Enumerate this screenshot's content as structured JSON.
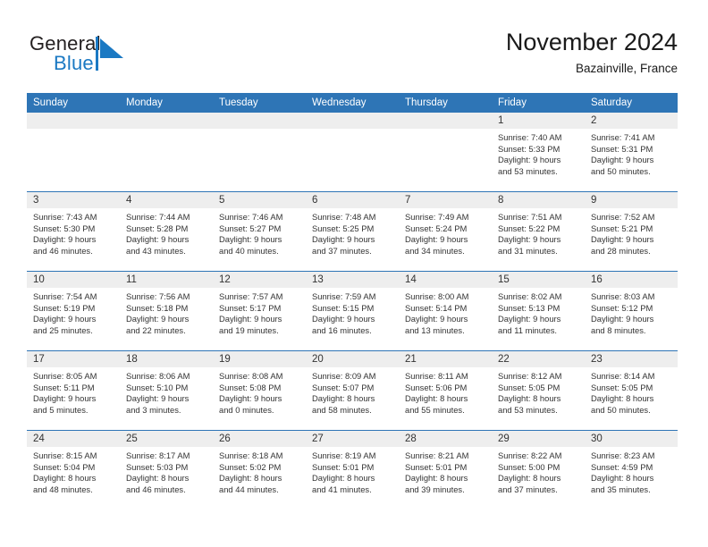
{
  "brand": {
    "word_one": "General",
    "word_two": "Blue",
    "mark_icon": "blue-triangle-flag-icon"
  },
  "header": {
    "title": "November 2024",
    "subtitle": "Bazainville, France"
  },
  "colors": {
    "header_bar": "#2e75b6",
    "day_band": "#eeeeee",
    "brand_blue": "#1b79c3",
    "text": "#333333"
  },
  "weekdays": [
    "Sunday",
    "Monday",
    "Tuesday",
    "Wednesday",
    "Thursday",
    "Friday",
    "Saturday"
  ],
  "weeks": [
    [
      {
        "day": "",
        "empty": true
      },
      {
        "day": "",
        "empty": true
      },
      {
        "day": "",
        "empty": true
      },
      {
        "day": "",
        "empty": true
      },
      {
        "day": "",
        "empty": true
      },
      {
        "day": "1",
        "sunrise": "Sunrise: 7:40 AM",
        "sunset": "Sunset: 5:33 PM",
        "daylight_1": "Daylight: 9 hours",
        "daylight_2": "and 53 minutes."
      },
      {
        "day": "2",
        "sunrise": "Sunrise: 7:41 AM",
        "sunset": "Sunset: 5:31 PM",
        "daylight_1": "Daylight: 9 hours",
        "daylight_2": "and 50 minutes."
      }
    ],
    [
      {
        "day": "3",
        "sunrise": "Sunrise: 7:43 AM",
        "sunset": "Sunset: 5:30 PM",
        "daylight_1": "Daylight: 9 hours",
        "daylight_2": "and 46 minutes."
      },
      {
        "day": "4",
        "sunrise": "Sunrise: 7:44 AM",
        "sunset": "Sunset: 5:28 PM",
        "daylight_1": "Daylight: 9 hours",
        "daylight_2": "and 43 minutes."
      },
      {
        "day": "5",
        "sunrise": "Sunrise: 7:46 AM",
        "sunset": "Sunset: 5:27 PM",
        "daylight_1": "Daylight: 9 hours",
        "daylight_2": "and 40 minutes."
      },
      {
        "day": "6",
        "sunrise": "Sunrise: 7:48 AM",
        "sunset": "Sunset: 5:25 PM",
        "daylight_1": "Daylight: 9 hours",
        "daylight_2": "and 37 minutes."
      },
      {
        "day": "7",
        "sunrise": "Sunrise: 7:49 AM",
        "sunset": "Sunset: 5:24 PM",
        "daylight_1": "Daylight: 9 hours",
        "daylight_2": "and 34 minutes."
      },
      {
        "day": "8",
        "sunrise": "Sunrise: 7:51 AM",
        "sunset": "Sunset: 5:22 PM",
        "daylight_1": "Daylight: 9 hours",
        "daylight_2": "and 31 minutes."
      },
      {
        "day": "9",
        "sunrise": "Sunrise: 7:52 AM",
        "sunset": "Sunset: 5:21 PM",
        "daylight_1": "Daylight: 9 hours",
        "daylight_2": "and 28 minutes."
      }
    ],
    [
      {
        "day": "10",
        "sunrise": "Sunrise: 7:54 AM",
        "sunset": "Sunset: 5:19 PM",
        "daylight_1": "Daylight: 9 hours",
        "daylight_2": "and 25 minutes."
      },
      {
        "day": "11",
        "sunrise": "Sunrise: 7:56 AM",
        "sunset": "Sunset: 5:18 PM",
        "daylight_1": "Daylight: 9 hours",
        "daylight_2": "and 22 minutes."
      },
      {
        "day": "12",
        "sunrise": "Sunrise: 7:57 AM",
        "sunset": "Sunset: 5:17 PM",
        "daylight_1": "Daylight: 9 hours",
        "daylight_2": "and 19 minutes."
      },
      {
        "day": "13",
        "sunrise": "Sunrise: 7:59 AM",
        "sunset": "Sunset: 5:15 PM",
        "daylight_1": "Daylight: 9 hours",
        "daylight_2": "and 16 minutes."
      },
      {
        "day": "14",
        "sunrise": "Sunrise: 8:00 AM",
        "sunset": "Sunset: 5:14 PM",
        "daylight_1": "Daylight: 9 hours",
        "daylight_2": "and 13 minutes."
      },
      {
        "day": "15",
        "sunrise": "Sunrise: 8:02 AM",
        "sunset": "Sunset: 5:13 PM",
        "daylight_1": "Daylight: 9 hours",
        "daylight_2": "and 11 minutes."
      },
      {
        "day": "16",
        "sunrise": "Sunrise: 8:03 AM",
        "sunset": "Sunset: 5:12 PM",
        "daylight_1": "Daylight: 9 hours",
        "daylight_2": "and 8 minutes."
      }
    ],
    [
      {
        "day": "17",
        "sunrise": "Sunrise: 8:05 AM",
        "sunset": "Sunset: 5:11 PM",
        "daylight_1": "Daylight: 9 hours",
        "daylight_2": "and 5 minutes."
      },
      {
        "day": "18",
        "sunrise": "Sunrise: 8:06 AM",
        "sunset": "Sunset: 5:10 PM",
        "daylight_1": "Daylight: 9 hours",
        "daylight_2": "and 3 minutes."
      },
      {
        "day": "19",
        "sunrise": "Sunrise: 8:08 AM",
        "sunset": "Sunset: 5:08 PM",
        "daylight_1": "Daylight: 9 hours",
        "daylight_2": "and 0 minutes."
      },
      {
        "day": "20",
        "sunrise": "Sunrise: 8:09 AM",
        "sunset": "Sunset: 5:07 PM",
        "daylight_1": "Daylight: 8 hours",
        "daylight_2": "and 58 minutes."
      },
      {
        "day": "21",
        "sunrise": "Sunrise: 8:11 AM",
        "sunset": "Sunset: 5:06 PM",
        "daylight_1": "Daylight: 8 hours",
        "daylight_2": "and 55 minutes."
      },
      {
        "day": "22",
        "sunrise": "Sunrise: 8:12 AM",
        "sunset": "Sunset: 5:05 PM",
        "daylight_1": "Daylight: 8 hours",
        "daylight_2": "and 53 minutes."
      },
      {
        "day": "23",
        "sunrise": "Sunrise: 8:14 AM",
        "sunset": "Sunset: 5:05 PM",
        "daylight_1": "Daylight: 8 hours",
        "daylight_2": "and 50 minutes."
      }
    ],
    [
      {
        "day": "24",
        "sunrise": "Sunrise: 8:15 AM",
        "sunset": "Sunset: 5:04 PM",
        "daylight_1": "Daylight: 8 hours",
        "daylight_2": "and 48 minutes."
      },
      {
        "day": "25",
        "sunrise": "Sunrise: 8:17 AM",
        "sunset": "Sunset: 5:03 PM",
        "daylight_1": "Daylight: 8 hours",
        "daylight_2": "and 46 minutes."
      },
      {
        "day": "26",
        "sunrise": "Sunrise: 8:18 AM",
        "sunset": "Sunset: 5:02 PM",
        "daylight_1": "Daylight: 8 hours",
        "daylight_2": "and 44 minutes."
      },
      {
        "day": "27",
        "sunrise": "Sunrise: 8:19 AM",
        "sunset": "Sunset: 5:01 PM",
        "daylight_1": "Daylight: 8 hours",
        "daylight_2": "and 41 minutes."
      },
      {
        "day": "28",
        "sunrise": "Sunrise: 8:21 AM",
        "sunset": "Sunset: 5:01 PM",
        "daylight_1": "Daylight: 8 hours",
        "daylight_2": "and 39 minutes."
      },
      {
        "day": "29",
        "sunrise": "Sunrise: 8:22 AM",
        "sunset": "Sunset: 5:00 PM",
        "daylight_1": "Daylight: 8 hours",
        "daylight_2": "and 37 minutes."
      },
      {
        "day": "30",
        "sunrise": "Sunrise: 8:23 AM",
        "sunset": "Sunset: 4:59 PM",
        "daylight_1": "Daylight: 8 hours",
        "daylight_2": "and 35 minutes."
      }
    ]
  ]
}
